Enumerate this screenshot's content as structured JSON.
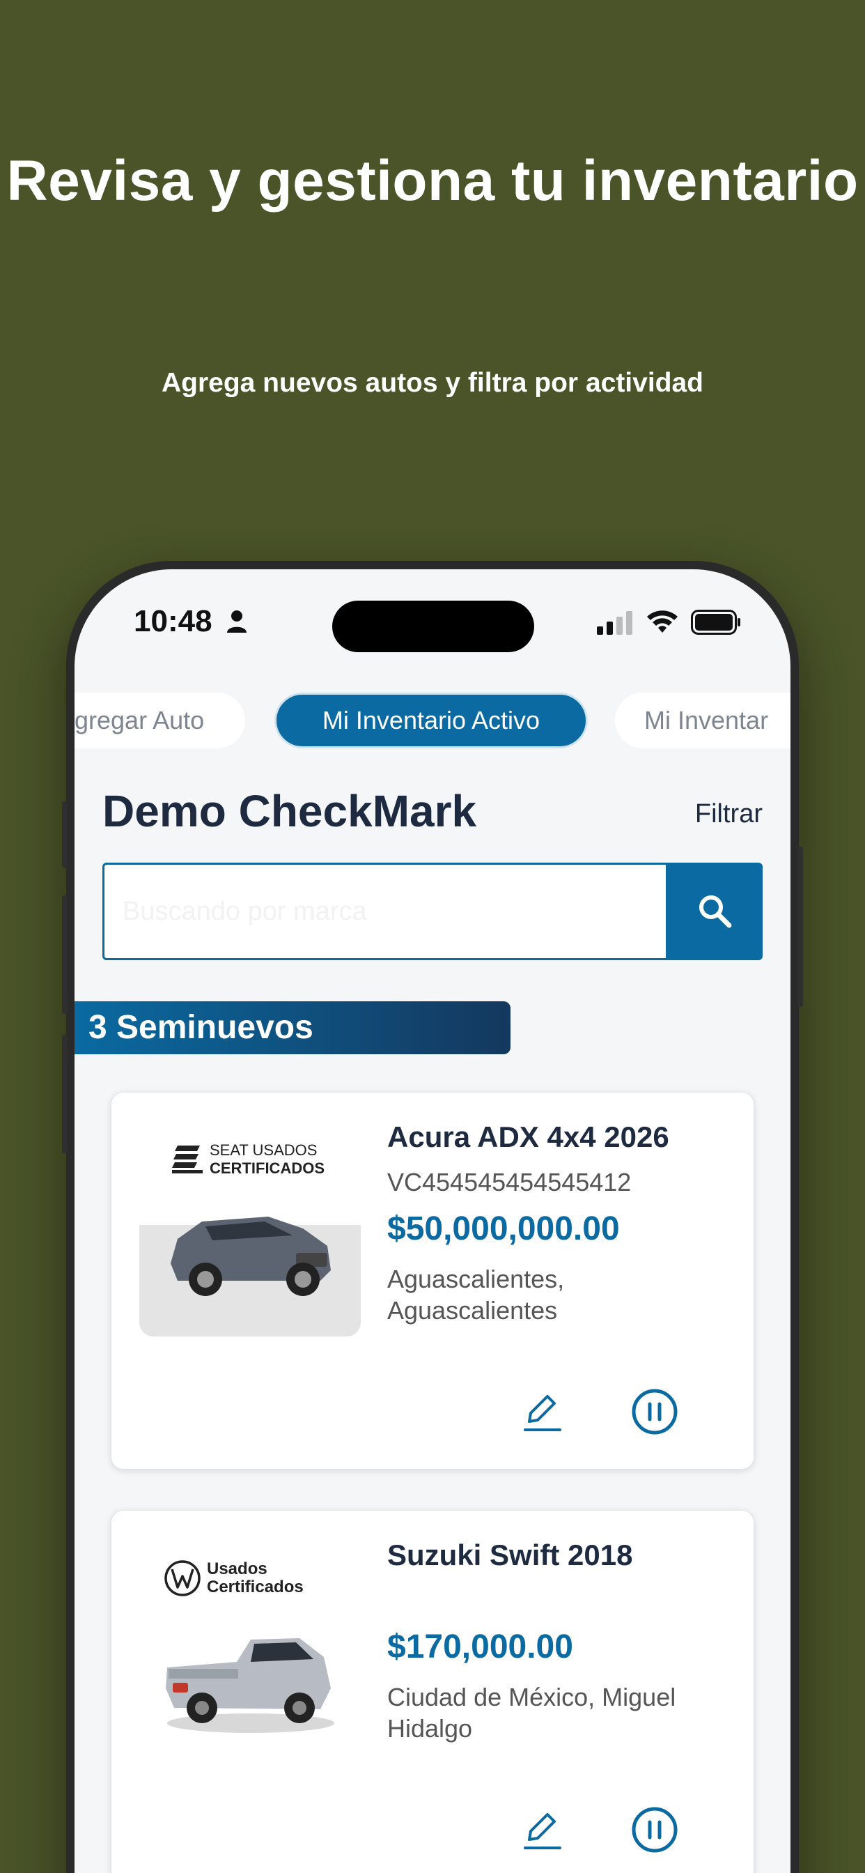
{
  "hero": {
    "title": "Revisa y gestiona tu inventario",
    "subtitle": "Agrega nuevos autos y filtra por actividad"
  },
  "status_bar": {
    "time": "10:48"
  },
  "tabs": [
    {
      "label": "gregar Auto",
      "active": false
    },
    {
      "label": "Mi Inventario Activo",
      "active": true
    },
    {
      "label": "Mi Inventar",
      "active": false
    }
  ],
  "header": {
    "title": "Demo CheckMark",
    "filter_label": "Filtrar"
  },
  "search": {
    "placeholder": "Buscando por marca"
  },
  "results": {
    "count_label": "3 Seminuevos"
  },
  "cars": [
    {
      "logo_line1": "SEAT USADOS",
      "logo_line2": "CERTIFICADOS",
      "name": "Acura ADX 4x4 2026",
      "vin": "VC454545454545412",
      "price": "$50,000,000.00",
      "location": "Aguascalientes, Aguascalientes"
    },
    {
      "logo_line1": "Usados",
      "logo_line2": "Certificados",
      "name": "Suzuki Swift 2018",
      "vin": "",
      "price": "$170,000.00",
      "location": "Ciudad de México, Miguel Hidalgo"
    }
  ],
  "colors": {
    "background": "#4a5428",
    "accent": "#0a6aa1",
    "text_dark": "#1d2a3f"
  },
  "icons": [
    "person-icon",
    "signal-icon",
    "wifi-icon",
    "battery-icon",
    "search-icon",
    "edit-icon",
    "pause-icon",
    "seat-logo-icon",
    "vw-logo-icon"
  ]
}
